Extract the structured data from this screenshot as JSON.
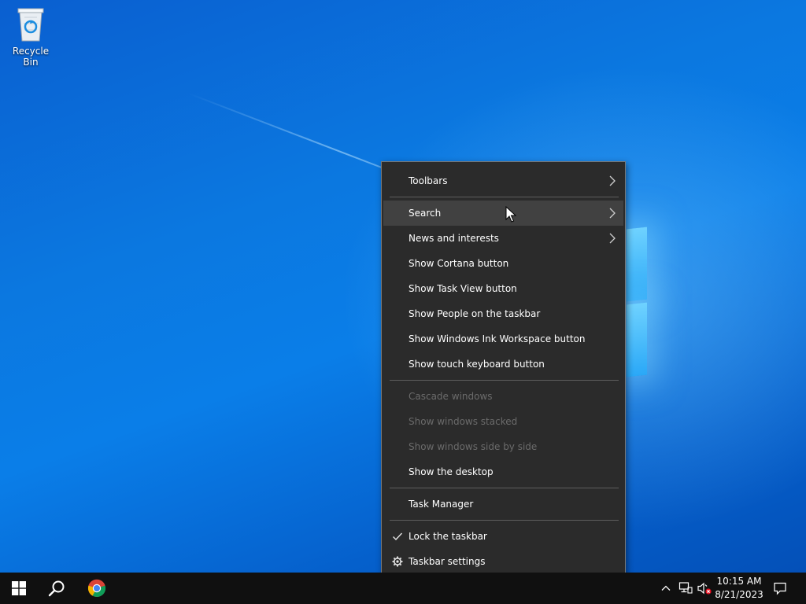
{
  "desktop": {
    "icons": [
      {
        "label": "Recycle Bin",
        "icon": "recycle-bin-icon"
      }
    ]
  },
  "context_menu": {
    "items": [
      {
        "label": "Toolbars",
        "submenu": true,
        "enabled": true
      },
      {
        "label": "Search",
        "submenu": true,
        "enabled": true,
        "hovered": true
      },
      {
        "label": "News and interests",
        "submenu": true,
        "enabled": true
      },
      {
        "label": "Show Cortana button",
        "enabled": true
      },
      {
        "label": "Show Task View button",
        "enabled": true
      },
      {
        "label": "Show People on the taskbar",
        "enabled": true
      },
      {
        "label": "Show Windows Ink Workspace button",
        "enabled": true
      },
      {
        "label": "Show touch keyboard button",
        "enabled": true
      },
      {
        "label": "Cascade windows",
        "enabled": false
      },
      {
        "label": "Show windows stacked",
        "enabled": false
      },
      {
        "label": "Show windows side by side",
        "enabled": false
      },
      {
        "label": "Show the desktop",
        "enabled": true
      },
      {
        "label": "Task Manager",
        "enabled": true
      },
      {
        "label": "Lock the taskbar",
        "enabled": true,
        "checked": true,
        "icon": "checkmark-icon"
      },
      {
        "label": "Taskbar settings",
        "enabled": true,
        "icon": "gear-icon"
      }
    ]
  },
  "taskbar": {
    "pinned": [
      {
        "icon": "windows-start-icon"
      },
      {
        "icon": "search-icon"
      },
      {
        "icon": "chrome-icon"
      }
    ],
    "tray": {
      "icons": [
        "chevron-up-icon",
        "network-icon",
        "volume-muted-icon"
      ],
      "time": "10:15 AM",
      "date": "8/21/2023",
      "notification_icon": "action-center-icon"
    }
  },
  "colors": {
    "menu_bg": "#2b2b2b",
    "menu_hover": "#414141",
    "menu_disabled_text": "#6b6b6b",
    "taskbar_bg": "#101010",
    "desktop_blue": "#0a78e0"
  }
}
